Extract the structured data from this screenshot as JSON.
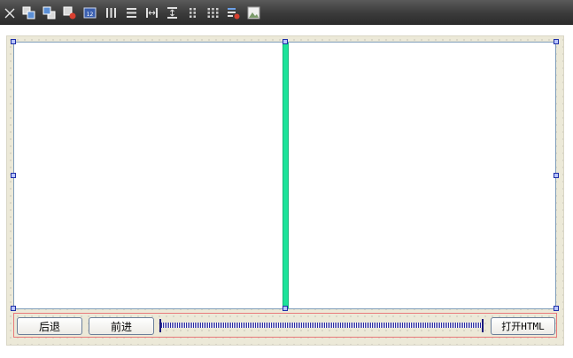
{
  "toolbar": {
    "items": [
      {
        "icon": "close-icon"
      },
      {
        "icon": "bring-to-front-icon"
      },
      {
        "icon": "send-to-back-icon"
      },
      {
        "icon": "delete-control-icon"
      },
      {
        "icon": "tab-order-icon"
      },
      {
        "icon": "align-columns-icon"
      },
      {
        "icon": "align-rows-icon"
      },
      {
        "icon": "same-width-icon"
      },
      {
        "icon": "same-height-icon"
      },
      {
        "icon": "grid-2col-icon"
      },
      {
        "icon": "grid-3col-icon"
      },
      {
        "icon": "properties-icon"
      },
      {
        "icon": "preview-icon"
      }
    ]
  },
  "colors": {
    "toolbar_bg": "#3b3b3b",
    "canvas_bg": "#ece9d8",
    "splitter": "#1ce39a",
    "handle_border": "#1f2fa8",
    "bar_border": "#e87a7a"
  },
  "bottom_bar": {
    "back_label": "后退",
    "forward_label": "前进",
    "open_html_label": "打开HTML"
  }
}
